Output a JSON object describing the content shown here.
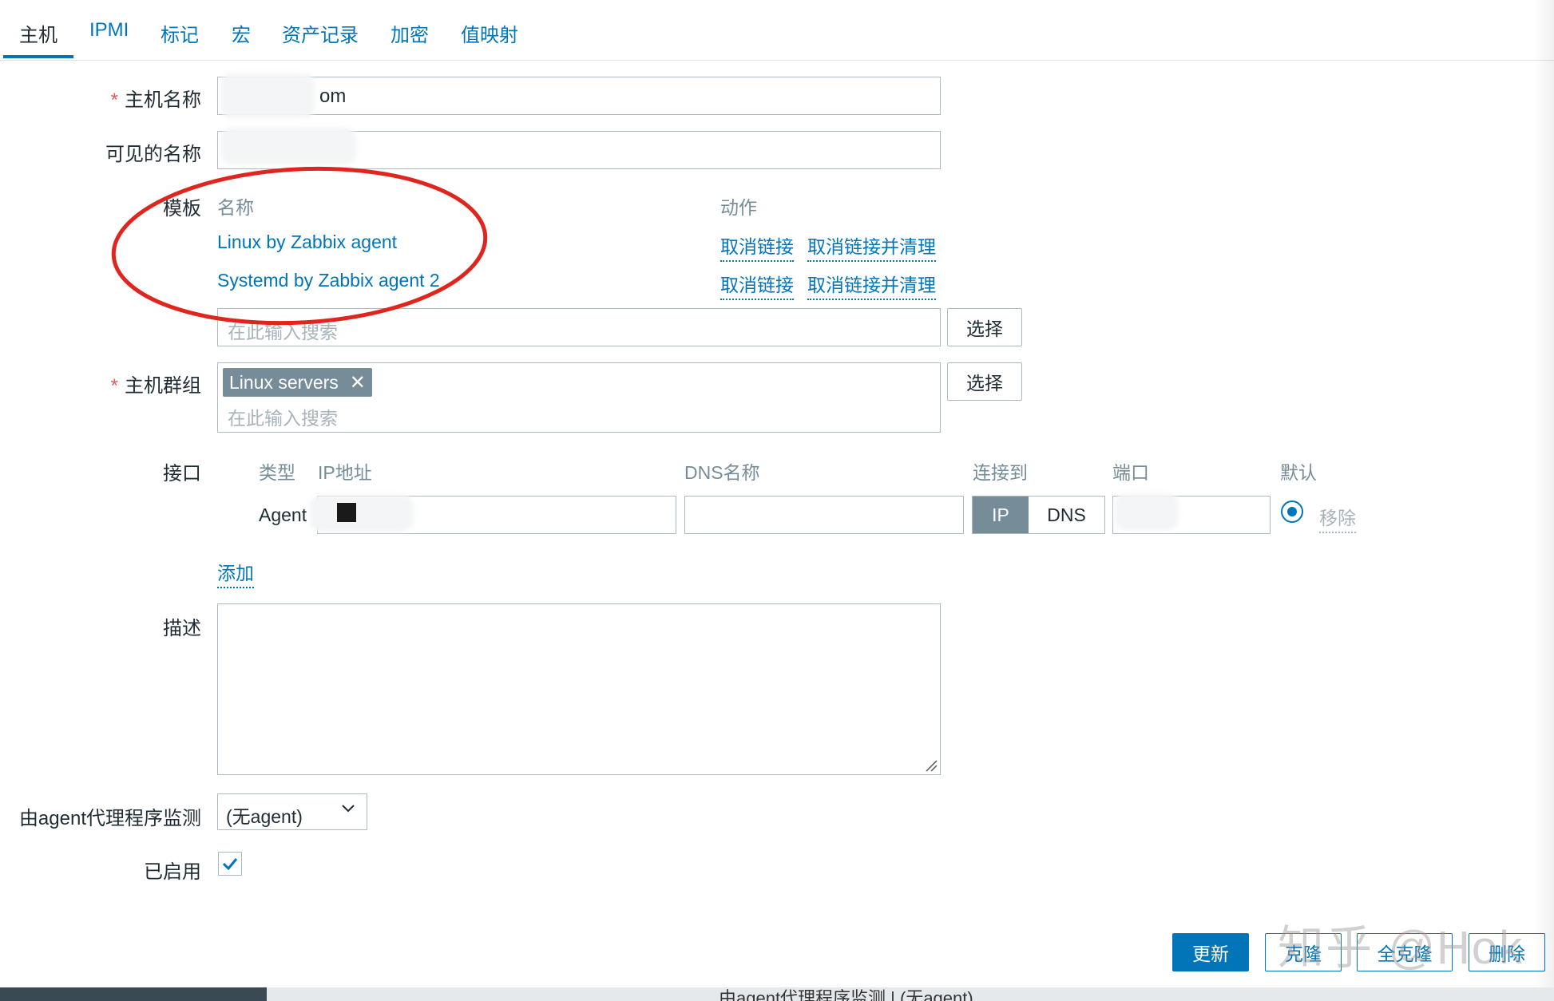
{
  "tabs": [
    {
      "label": "主机",
      "active": true
    },
    {
      "label": "IPMI"
    },
    {
      "label": "标记"
    },
    {
      "label": "宏"
    },
    {
      "label": "资产记录"
    },
    {
      "label": "加密"
    },
    {
      "label": "值映射"
    }
  ],
  "form": {
    "host_name": {
      "label": "主机名称",
      "value": "om"
    },
    "visible_name": {
      "label": "可见的名称",
      "value": ""
    },
    "templates": {
      "label": "模板",
      "col_name": "名称",
      "col_action": "动作",
      "rows": [
        {
          "name": "Linux by Zabbix agent",
          "unlink": "取消链接",
          "unlink_clear": "取消链接并清理"
        },
        {
          "name": "Systemd by Zabbix agent 2",
          "unlink": "取消链接",
          "unlink_clear": "取消链接并清理"
        }
      ],
      "search_placeholder": "在此输入搜索",
      "select_button": "选择"
    },
    "host_groups": {
      "label": "主机群组",
      "chips": [
        "Linux servers"
      ],
      "search_placeholder": "在此输入搜索",
      "select_button": "选择"
    },
    "interfaces": {
      "label": "接口",
      "headers": {
        "type": "类型",
        "ip": "IP地址",
        "dns": "DNS名称",
        "connect_to": "连接到",
        "port": "端口",
        "default": "默认"
      },
      "row": {
        "type": "Agent",
        "ip": "",
        "dns": "",
        "connect_ip": "IP",
        "connect_dns": "DNS",
        "port": "",
        "remove": "移除"
      },
      "add": "添加"
    },
    "description": {
      "label": "描述",
      "value": ""
    },
    "proxy": {
      "label": "由agent代理程序监测",
      "value": "(无agent)"
    },
    "enabled": {
      "label": "已启用",
      "checked": true
    }
  },
  "actions": {
    "update": "更新",
    "clone": "克隆",
    "full_clone": "全克隆",
    "delete": "删除"
  },
  "watermark": "知乎 @Hok",
  "background_strip": "由agent代理程序监测 | (无agent)",
  "colors": {
    "accent": "#0275b8",
    "chip": "#768d99",
    "annotation": "#e0251f"
  }
}
